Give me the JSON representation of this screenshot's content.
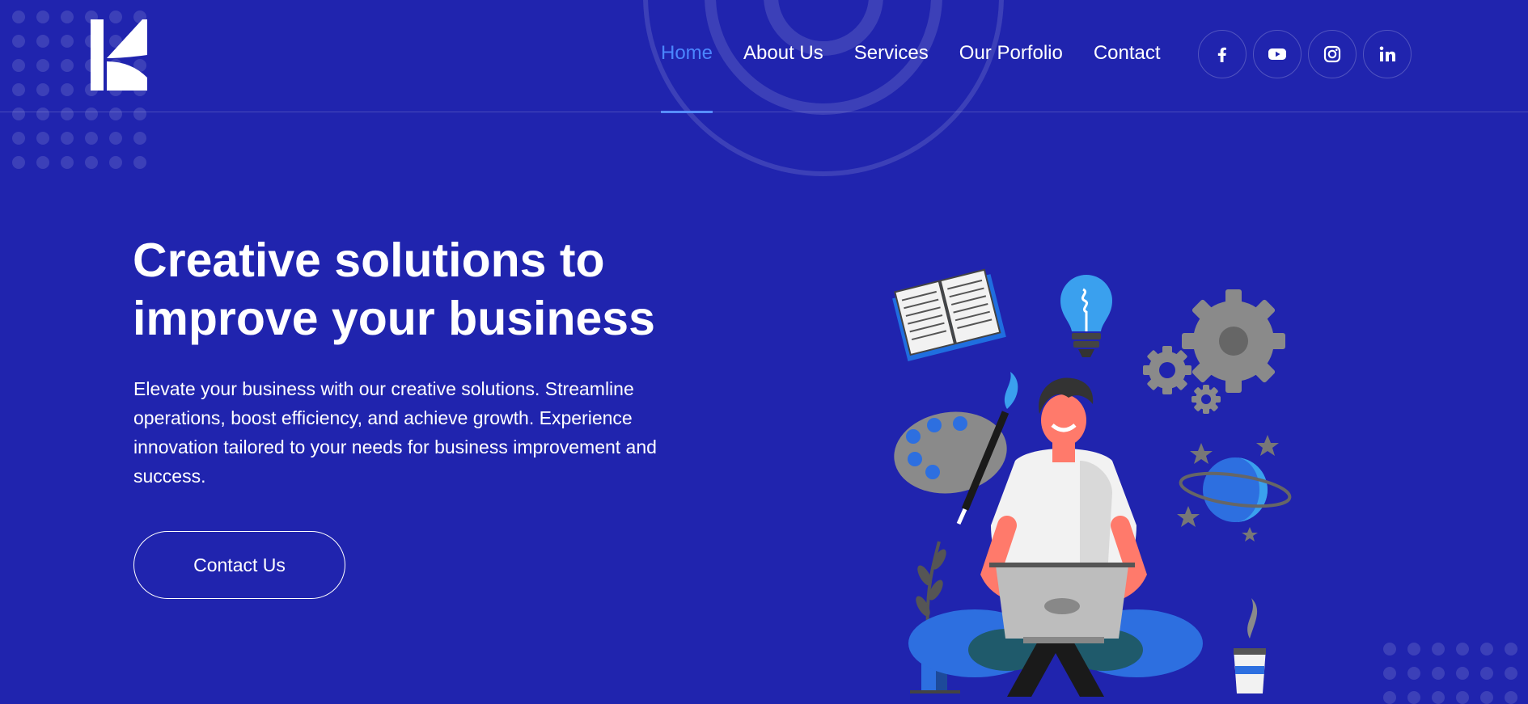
{
  "header": {
    "logo_icon": "k-letter-logo-icon",
    "nav": [
      {
        "label": "Home",
        "active": true
      },
      {
        "label": "About Us",
        "active": false
      },
      {
        "label": "Services",
        "active": false
      },
      {
        "label": "Our Porfolio",
        "active": false
      },
      {
        "label": "Contact",
        "active": false
      }
    ],
    "socials": [
      "facebook-icon",
      "youtube-icon",
      "instagram-icon",
      "linkedin-icon"
    ]
  },
  "hero": {
    "title_line1": "Creative solutions to",
    "title_line2": "improve your business",
    "description": "Elevate your business with our creative solutions. Streamline operations, boost efficiency, and achieve growth. Experience innovation tailored to your needs for business improvement and success.",
    "cta_label": "Contact Us"
  },
  "colors": {
    "background": "#2024AE",
    "accent": "#4B86FF",
    "text": "#FFFFFF"
  }
}
